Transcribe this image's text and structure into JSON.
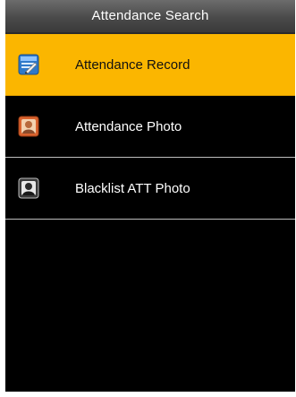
{
  "header": {
    "title": "Attendance Search"
  },
  "menu": {
    "items": [
      {
        "label": "Attendance Record",
        "icon": "record-edit-icon",
        "selected": true
      },
      {
        "label": "Attendance Photo",
        "icon": "photo-icon",
        "selected": false
      },
      {
        "label": "Blacklist ATT Photo",
        "icon": "blacklist-photo-icon",
        "selected": false
      }
    ]
  },
  "colors": {
    "highlight": "#fbb600",
    "background": "#000000",
    "titlebar": "#4a4a4a"
  }
}
